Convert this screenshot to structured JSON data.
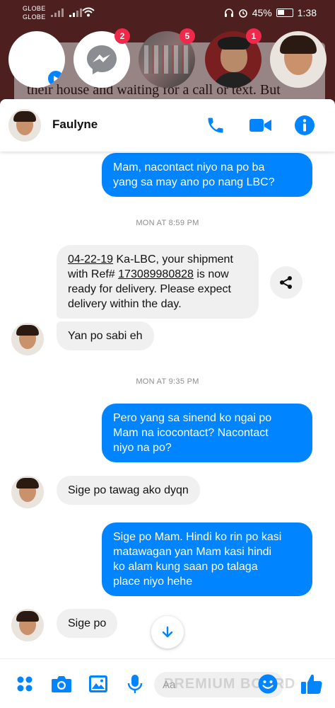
{
  "status_bar": {
    "carrier_1": "GLOBE",
    "carrier_2": "GLOBE",
    "battery": "45%",
    "time": "1:38"
  },
  "background_page": {
    "text": "their house and waiting for a call or text. But"
  },
  "chat_heads": [
    {
      "name": "blank-head",
      "badge": null
    },
    {
      "name": "messenger-head",
      "badge": "2"
    },
    {
      "name": "group-head",
      "badge": "5"
    },
    {
      "name": "contact-head",
      "badge": "1"
    },
    {
      "name": "faulyne-head",
      "badge": null
    }
  ],
  "header": {
    "contact_name": "Faulyne"
  },
  "messages": {
    "m1": "Mam, nacontact niyo na po ba\nyang sa may ano po nang LBC?",
    "ts1": "MON AT 8:59 PM",
    "m2_date": "04-22-19",
    "m2_a": " Ka-LBC, your shipment\nwith Ref# ",
    "m2_ref": "173089980828",
    "m2_b": " is now\nready for delivery. Please expect\ndelivery within the day.",
    "m3": "Yan po sabi eh",
    "ts2": "MON AT 9:35 PM",
    "m4": "Pero yang sa sinend ko ngai po\nMam na icocontact? Nacontact\nniyo na po?",
    "m5": "Sige po tawag ako dyqn",
    "m6": "Sige po Mam. Hindi ko rin po kasi\nmatawagan yan Mam kasi hindi\nko alam kung saan po talaga\nplace niyo hehe",
    "m7": "Sige po"
  },
  "composer": {
    "placeholder": "Aa",
    "watermark": "PREMIUM BOARD"
  },
  "colors": {
    "accent": "#0084ff",
    "incoming_bubble": "#f1f0f0",
    "badge": "#f02849",
    "header_bg": "#6e3a3a"
  }
}
